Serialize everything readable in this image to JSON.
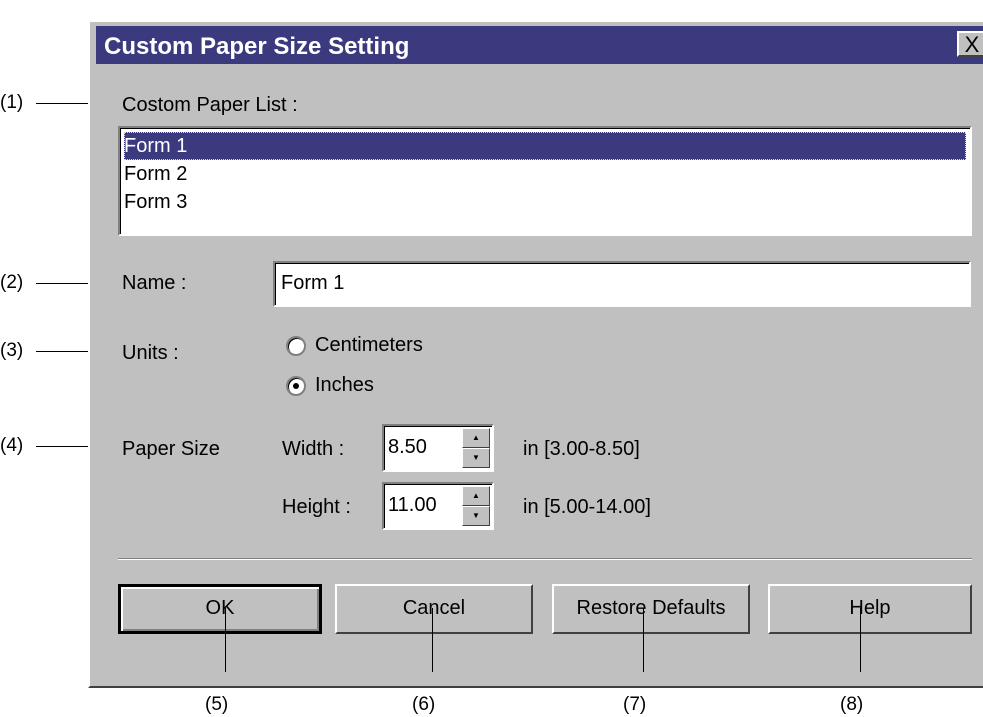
{
  "dialog": {
    "title": "Custom Paper Size Setting",
    "close_label": "X"
  },
  "paper_list": {
    "label": "Costom Paper List :",
    "items": [
      "Form 1",
      "Form 2",
      "Form 3"
    ],
    "selected": "Form 1"
  },
  "name": {
    "label": "Name :",
    "value": "Form 1"
  },
  "units": {
    "label": "Units :",
    "options": [
      "Centimeters",
      "Inches"
    ],
    "selected": "Inches"
  },
  "paper_size": {
    "label": "Paper Size",
    "width": {
      "label": "Width :",
      "value": "8.50",
      "range": "in [3.00-8.50]"
    },
    "height": {
      "label": "Height :",
      "value": "11.00",
      "range": "in [5.00-14.00]"
    }
  },
  "buttons": {
    "ok": "OK",
    "cancel": "Cancel",
    "restore": "Restore Defaults",
    "help": "Help"
  },
  "callouts": [
    "(1)",
    "(2)",
    "(3)",
    "(4)",
    "(5)",
    "(6)",
    "(7)",
    "(8)"
  ],
  "colors": {
    "titlebar": "#3c3a7e",
    "dialog_bg": "#c0c0c0",
    "selection": "#3c3a7e"
  }
}
